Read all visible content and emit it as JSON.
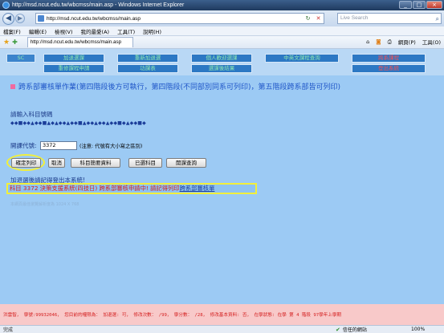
{
  "window": {
    "title": "http://msd.ncut.edu.tw/wbcmss/main.asp - Windows Internet Explorer",
    "controls": [
      "_",
      "□",
      "×"
    ]
  },
  "address_bar": {
    "url": "http://msd.ncut.edu.tw/wbcmss/main.asp",
    "search_placeholder": "Live Search",
    "back_icon": "back-arrow-icon",
    "forward_icon": "forward-arrow-icon"
  },
  "menu": [
    "檔案(F)",
    "編輯(E)",
    "檢視(V)",
    "我的最愛(A)",
    "工具(T)",
    "說明(H)"
  ],
  "favorites_bar": {
    "tab_title": "http://msd.ncut.edu.tw/wbcmss/main.asp",
    "page_label": "網頁(P)",
    "tools_label": "工具(O)"
  },
  "site_nav": {
    "row1": [
      {
        "label": "SC",
        "color": "#8fe8b0"
      },
      {
        "label": "加退選課",
        "color": "#8fe8b0"
      },
      {
        "label": "重新加退選",
        "color": "#8fe8b0"
      },
      {
        "label": "個人歡迎選課",
        "color": "#8fe8b0"
      },
      {
        "label": "中英文課程查詢",
        "color": "#8fe8b0"
      },
      {
        "label": "跨系課程",
        "color": "#ff4d4d"
      }
    ],
    "row2": [
      {
        "label": "重修課程申請",
        "color": "#8fe8b0"
      },
      {
        "label": "功課表",
        "color": "#8fe8b0"
      },
      {
        "label": "選課後結果",
        "color": "#8fe8b0"
      },
      {
        "label": "登出系統",
        "color": "#ff4d4d"
      }
    ]
  },
  "main": {
    "heading": "跨系部審核單作業(第四階段後方可執行，第四階段(不同部別同系可列印)，第五階段跨系部皆可列印)",
    "prompt": "請輸入科目號碼",
    "code_pattern": "◆◆■◆◆▲◆◆■▲◆▲◆◆▲◆◆■▲◆◆▲◆◆▲◆◆■◆▲◆◆■◆",
    "code_label": "開課代號:",
    "code_value": "3372",
    "code_note": "(注意: 代號有大小寫之區別)",
    "buttons": [
      "確定列印",
      "取消",
      "科目簡要資料",
      "已選科目",
      "開課查詢"
    ],
    "instruction": "加退選後請記得登出本系統!",
    "message_red": "科目 3372 決策支援系統(四技日) 跨系部審核申請中! 請記得列印",
    "message_link": "跨系部審核單",
    "footnote": "本網頁最佳瀏覽解析度為 1024 X 768"
  },
  "student_status": {
    "text": "洪雲智， 學號:99932046， 您目前的權限為： 加退選: 可， 修改次數：  /99， 學分數： /28， 修改基本資料: 否， 在學狀態: 在學 第 4 階段 97學年上學期"
  },
  "status_bar": {
    "left": "完成",
    "zone": "信任的網站",
    "zoom": "100%"
  }
}
